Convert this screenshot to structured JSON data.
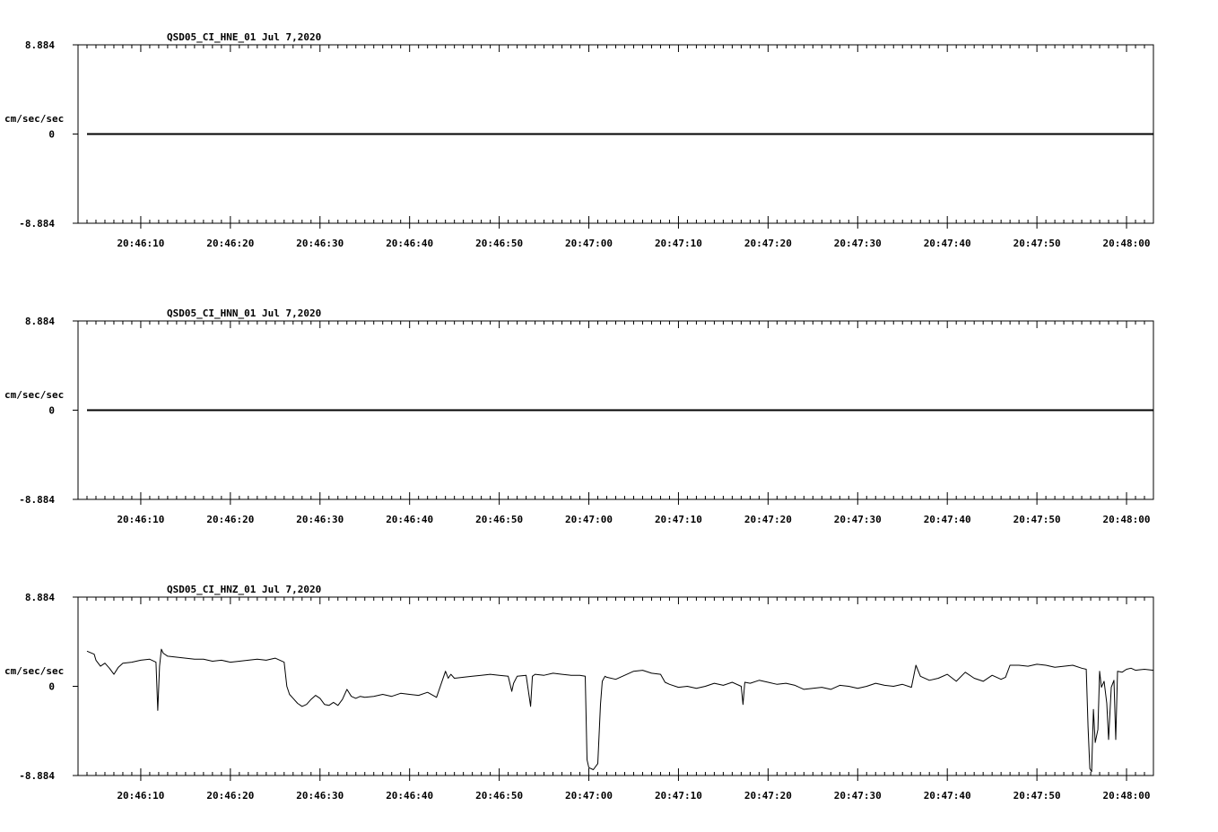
{
  "time_ticks": [
    "20:46:10",
    "20:46:20",
    "20:46:30",
    "20:46:40",
    "20:46:50",
    "20:47:00",
    "20:47:10",
    "20:47:20",
    "20:47:30",
    "20:47:40",
    "20:47:50",
    "20:48:00"
  ],
  "chart_data": [
    {
      "type": "line",
      "title": "QSD05_CI_HNE_01  Jul 7,2020",
      "ylabel": "cm/sec/sec",
      "ylim": [
        -8.884,
        8.884
      ],
      "ytick_labels": [
        "8.884",
        "0",
        "-8.884"
      ],
      "xlim": [
        "20:46:03",
        "20:48:03"
      ],
      "x_ticks": [
        "20:46:10",
        "20:46:20",
        "20:46:30",
        "20:46:40",
        "20:46:50",
        "20:47:00",
        "20:47:10",
        "20:47:20",
        "20:47:30",
        "20:47:40",
        "20:47:50",
        "20:48:00"
      ],
      "grid": false,
      "series": [
        {
          "x": [
            "20:46:04",
            "20:48:03"
          ],
          "values": [
            0,
            0
          ]
        }
      ]
    },
    {
      "type": "line",
      "title": "QSD05_CI_HNN_01  Jul 7,2020",
      "ylabel": "cm/sec/sec",
      "ylim": [
        -8.884,
        8.884
      ],
      "ytick_labels": [
        "8.884",
        "0",
        "-8.884"
      ],
      "xlim": [
        "20:46:03",
        "20:48:03"
      ],
      "x_ticks": [
        "20:46:10",
        "20:46:20",
        "20:46:30",
        "20:46:40",
        "20:46:50",
        "20:47:00",
        "20:47:10",
        "20:47:20",
        "20:47:30",
        "20:47:40",
        "20:47:50",
        "20:48:00"
      ],
      "grid": false,
      "series": [
        {
          "x": [
            "20:46:04",
            "20:48:03"
          ],
          "values": [
            0,
            0
          ]
        }
      ]
    },
    {
      "type": "line",
      "title": "QSD05_CI_HNZ_01  Jul 7,2020",
      "ylabel": "cm/sec/sec",
      "ylim": [
        -8.884,
        8.884
      ],
      "ytick_labels": [
        "8.884",
        "0",
        "-8.884"
      ],
      "xlim": [
        "20:46:03",
        "20:48:03"
      ],
      "x_ticks": [
        "20:46:10",
        "20:46:20",
        "20:46:30",
        "20:46:40",
        "20:46:50",
        "20:47:00",
        "20:47:10",
        "20:47:20",
        "20:47:30",
        "20:47:40",
        "20:47:50",
        "20:48:00"
      ],
      "grid": false,
      "series": [
        {
          "x": [
            "20:46:04.0",
            "20:46:04.8",
            "20:46:05.0",
            "20:46:05.5",
            "20:46:06.0",
            "20:46:06.5",
            "20:46:07.0",
            "20:46:07.5",
            "20:46:08.0",
            "20:46:09.0",
            "20:46:10.0",
            "20:46:11.0",
            "20:46:11.7",
            "20:46:11.9",
            "20:46:12.1",
            "20:46:12.3",
            "20:46:12.5",
            "20:46:13.0",
            "20:46:14.0",
            "20:46:15.0",
            "20:46:16.0",
            "20:46:17.0",
            "20:46:18.0",
            "20:46:19.0",
            "20:46:20.0",
            "20:46:21.0",
            "20:46:22.0",
            "20:46:23.0",
            "20:46:24.0",
            "20:46:25.0",
            "20:46:26.0",
            "20:46:26.3",
            "20:46:26.6",
            "20:46:27.0",
            "20:46:27.5",
            "20:46:28.0",
            "20:46:28.5",
            "20:46:29.0",
            "20:46:29.5",
            "20:46:30.0",
            "20:46:30.5",
            "20:46:31.0",
            "20:46:31.5",
            "20:46:32.0",
            "20:46:32.5",
            "20:46:33.0",
            "20:46:33.5",
            "20:46:34.0",
            "20:46:34.5",
            "20:46:35.0",
            "20:46:36.0",
            "20:46:37.0",
            "20:46:38.0",
            "20:46:39.0",
            "20:46:40.0",
            "20:46:41.0",
            "20:46:42.0",
            "20:46:43.0",
            "20:46:44.0",
            "20:46:44.3",
            "20:46:44.6",
            "20:46:45.0",
            "20:46:46.0",
            "20:46:47.0",
            "20:46:48.0",
            "20:46:49.0",
            "20:46:50.0",
            "20:46:51.0",
            "20:46:51.4",
            "20:46:51.6",
            "20:46:52.0",
            "20:46:53.0",
            "20:46:53.5",
            "20:46:53.7",
            "20:46:54.0",
            "20:46:55.0",
            "20:46:56.0",
            "20:46:57.0",
            "20:46:58.0",
            "20:46:59.0",
            "20:46:59.6",
            "20:46:59.8",
            "20:47:00.0",
            "20:47:00.5",
            "20:47:01.0",
            "20:47:01.3",
            "20:47:01.5",
            "20:47:01.8",
            "20:47:02.0",
            "20:47:03.0",
            "20:47:04.0",
            "20:47:05.0",
            "20:47:06.0",
            "20:47:07.0",
            "20:47:08.0",
            "20:47:08.5",
            "20:47:09.0",
            "20:47:10.0",
            "20:47:11.0",
            "20:47:12.0",
            "20:47:13.0",
            "20:47:14.0",
            "20:47:15.0",
            "20:47:16.0",
            "20:47:17.0",
            "20:47:17.2",
            "20:47:17.4",
            "20:47:18.0",
            "20:47:19.0",
            "20:47:20.0",
            "20:47:21.0",
            "20:47:22.0",
            "20:47:23.0",
            "20:47:24.0",
            "20:47:25.0",
            "20:47:26.0",
            "20:47:27.0",
            "20:47:28.0",
            "20:47:29.0",
            "20:47:30.0",
            "20:47:31.0",
            "20:47:32.0",
            "20:47:33.0",
            "20:47:34.0",
            "20:47:35.0",
            "20:47:36.0",
            "20:47:36.5",
            "20:47:37.0",
            "20:47:38.0",
            "20:47:39.0",
            "20:47:40.0",
            "20:47:41.0",
            "20:47:42.0",
            "20:47:43.0",
            "20:47:44.0",
            "20:47:45.0",
            "20:47:46.0",
            "20:47:46.5",
            "20:47:47.0",
            "20:47:48.0",
            "20:47:49.0",
            "20:47:50.0",
            "20:47:51.0",
            "20:47:52.0",
            "20:47:53.0",
            "20:47:54.0",
            "20:47:55.0",
            "20:47:55.5",
            "20:47:55.7",
            "20:47:55.9",
            "20:47:56.1",
            "20:47:56.3",
            "20:47:56.5",
            "20:47:56.8",
            "20:47:57.0",
            "20:47:57.2",
            "20:47:57.5",
            "20:47:57.8",
            "20:47:58.0",
            "20:47:58.3",
            "20:47:58.6",
            "20:47:58.8",
            "20:47:59.0",
            "20:47:59.5",
            "20:48:00.0",
            "20:48:00.5",
            "20:48:01.0",
            "20:48:02.0",
            "20:48:03.0"
          ],
          "values": [
            3.5,
            3.2,
            2.6,
            2.0,
            2.3,
            1.8,
            1.2,
            1.9,
            2.3,
            2.4,
            2.6,
            2.7,
            2.4,
            -2.4,
            2.0,
            3.7,
            3.3,
            3.0,
            2.9,
            2.8,
            2.7,
            2.7,
            2.5,
            2.6,
            2.4,
            2.5,
            2.6,
            2.7,
            2.6,
            2.8,
            2.4,
            0.0,
            -0.8,
            -1.2,
            -1.7,
            -2.0,
            -1.8,
            -1.3,
            -0.9,
            -1.2,
            -1.8,
            -1.9,
            -1.6,
            -1.9,
            -1.3,
            -0.3,
            -1.0,
            -1.2,
            -1.0,
            -1.1,
            -1.0,
            -0.8,
            -1.0,
            -0.7,
            -0.8,
            -0.9,
            -0.6,
            -1.1,
            1.5,
            0.8,
            1.2,
            0.8,
            0.9,
            1.0,
            1.1,
            1.2,
            1.1,
            1.0,
            -0.5,
            0.3,
            1.0,
            1.1,
            -2.0,
            1.0,
            1.2,
            1.1,
            1.3,
            1.2,
            1.1,
            1.1,
            1.0,
            -7.3,
            -8.1,
            -8.3,
            -7.7,
            -1.8,
            0.5,
            1.0,
            0.9,
            0.7,
            1.1,
            1.5,
            1.6,
            1.3,
            1.2,
            0.4,
            0.2,
            -0.1,
            0.0,
            -0.2,
            0.0,
            0.3,
            0.1,
            0.4,
            0.0,
            -1.8,
            0.4,
            0.3,
            0.6,
            0.4,
            0.2,
            0.3,
            0.1,
            -0.3,
            -0.2,
            -0.1,
            -0.3,
            0.1,
            0.0,
            -0.2,
            0.0,
            0.3,
            0.1,
            0.0,
            0.2,
            -0.1,
            2.1,
            1.0,
            0.6,
            0.8,
            1.2,
            0.5,
            1.4,
            0.8,
            0.5,
            1.1,
            0.7,
            0.9,
            2.1,
            2.1,
            2.0,
            2.2,
            2.1,
            1.9,
            2.0,
            2.1,
            1.8,
            1.7,
            -4.0,
            -8.2,
            -8.5,
            -2.3,
            -5.6,
            -4.3,
            1.5,
            -0.1,
            0.5,
            -1.7,
            -5.3,
            -0.1,
            0.6,
            -5.3,
            1.5,
            1.4,
            1.7,
            1.8,
            1.6,
            1.7,
            1.6
          ]
        }
      ]
    }
  ]
}
